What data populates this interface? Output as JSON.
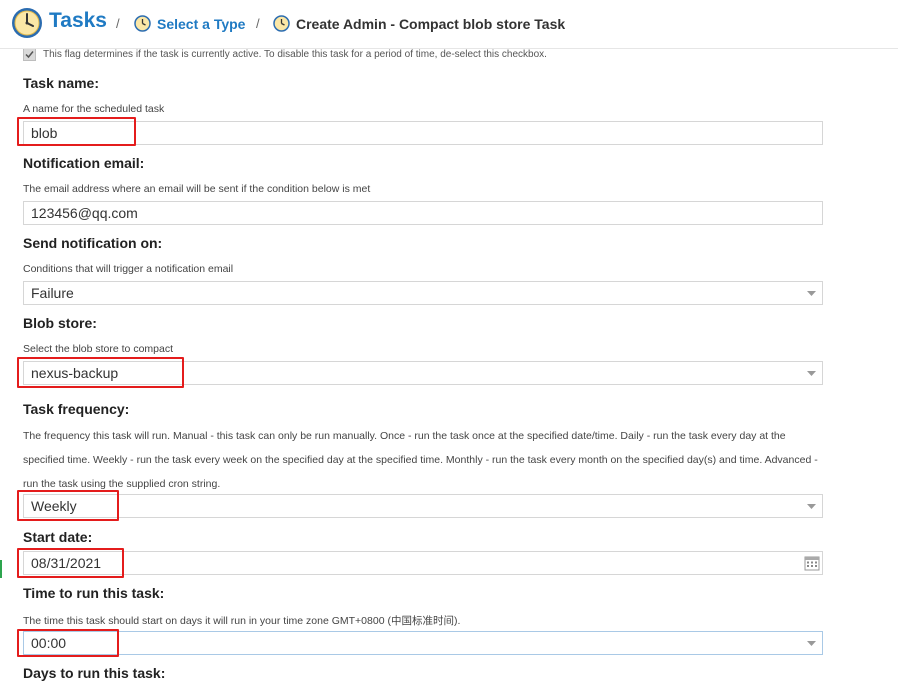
{
  "header": {
    "title": "Tasks",
    "separator": "/",
    "crumb_select_type": "Select a Type",
    "crumb_current": "Create Admin - Compact blob store Task"
  },
  "enabled_flag": {
    "checked": true,
    "help": "This flag determines if the task is currently active. To disable this task for a period of time, de-select this checkbox."
  },
  "task_name": {
    "label": "Task name:",
    "help": "A name for the scheduled task",
    "value": "blob"
  },
  "notification_email": {
    "label": "Notification email:",
    "help": "The email address where an email will be sent if the condition below is met",
    "value": "123456@qq.com"
  },
  "send_notification_on": {
    "label": "Send notification on:",
    "help": "Conditions that will trigger a notification email",
    "value": "Failure"
  },
  "blob_store": {
    "label": "Blob store:",
    "help": "Select the blob store to compact",
    "value": "nexus-backup"
  },
  "task_frequency": {
    "label": "Task frequency:",
    "help": "The frequency this task will run. Manual - this task can only be run manually. Once - run the task once at the specified date/time. Daily - run the task every day at the specified time. Weekly - run the task every week on the specified day at the specified time. Monthly - run the task every month on the specified day(s) and time. Advanced - run the task using the supplied cron string.",
    "value": "Weekly"
  },
  "start_date": {
    "label": "Start date:",
    "value": "08/31/2021"
  },
  "time_to_run": {
    "label": "Time to run this task:",
    "help": "The time this task should start on days it will run in your time zone GMT+0800 (中国标准时间).",
    "value": "00:00"
  },
  "days_to_run": {
    "label": "Days to run this task:"
  },
  "colors": {
    "accent": "#1f7ac3",
    "highlight": "#e41c1c"
  }
}
